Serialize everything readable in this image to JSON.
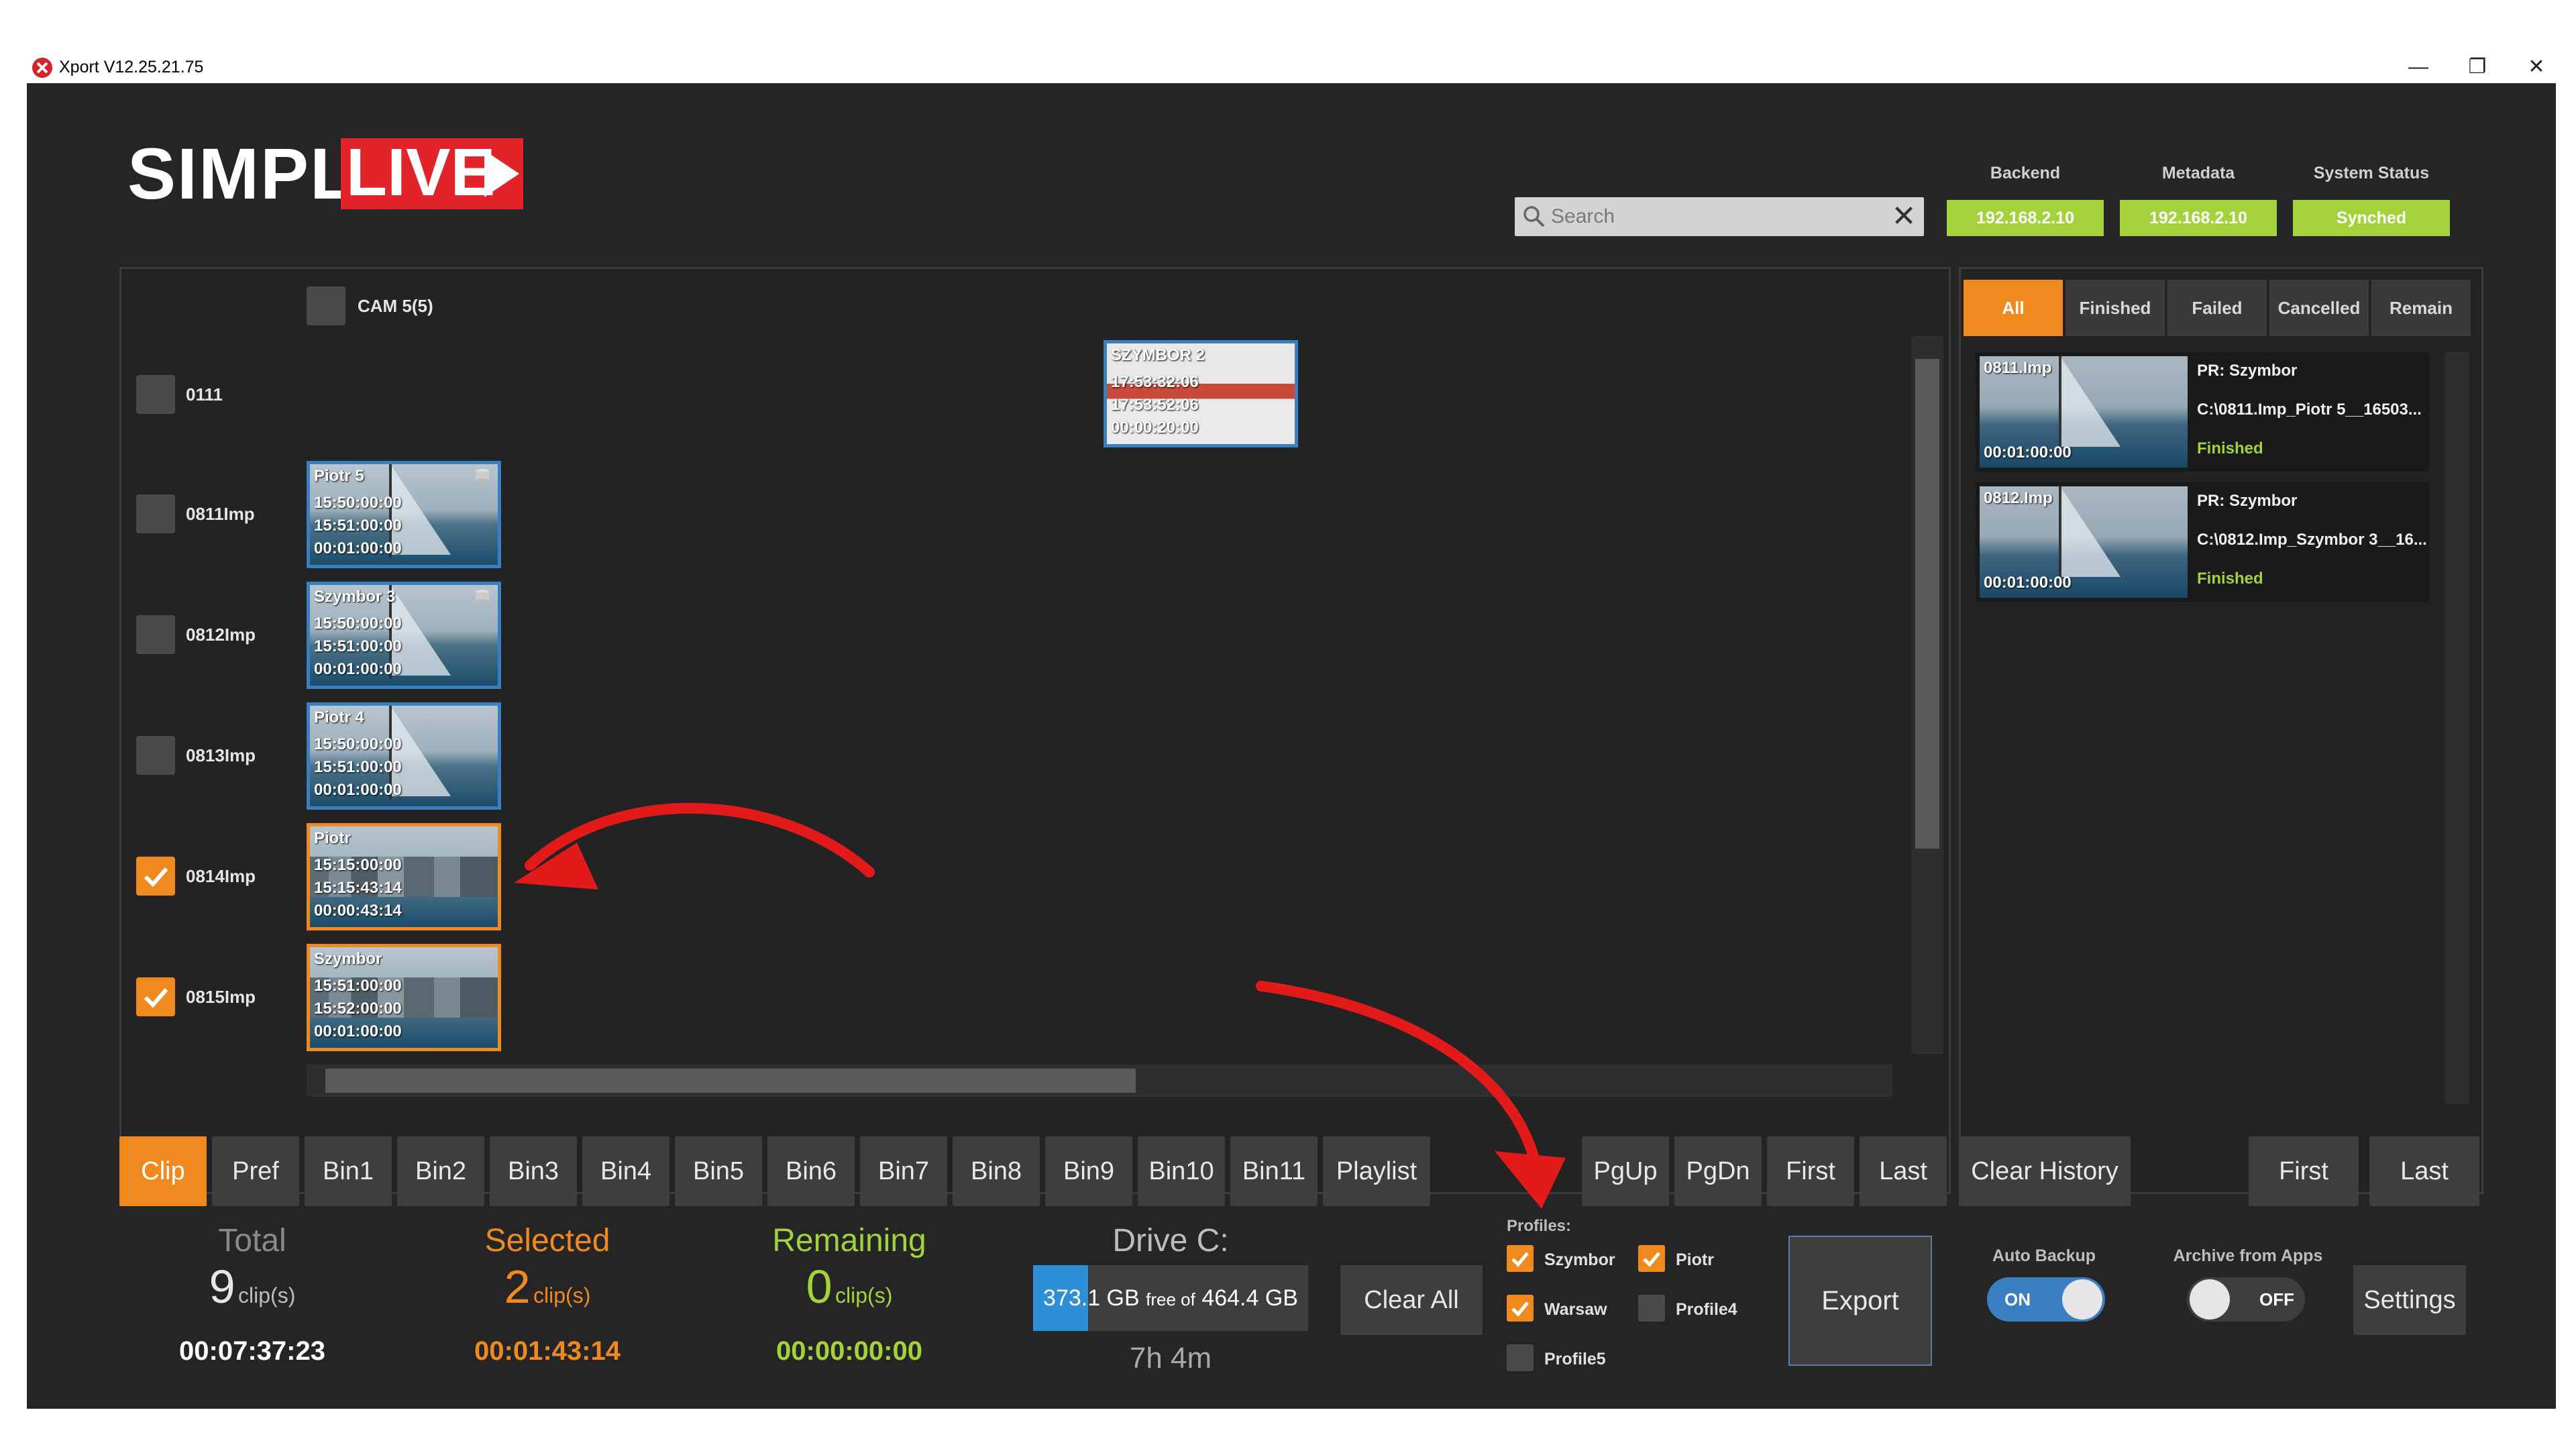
{
  "window": {
    "title": "Xport V12.25.21.75",
    "minimize": "—",
    "restore": "❐",
    "close": "✕"
  },
  "brand": {
    "simply": "SIMPLY",
    "live": "LIVE"
  },
  "search": {
    "placeholder": "Search",
    "clear": "✕"
  },
  "status": [
    {
      "label": "Backend",
      "value": "192.168.2.10"
    },
    {
      "label": "Metadata",
      "value": "192.168.2.10"
    },
    {
      "label": "System Status",
      "value": "Synched"
    }
  ],
  "clips": {
    "camera_label": "CAM 5(5)",
    "floating_clip": {
      "name": "SZYMBOR 2",
      "in": "17:53:32:06",
      "out": "17:53:52:06",
      "duration": "00:00:20:00"
    },
    "rows": [
      {
        "label": "0111",
        "checked": false
      },
      {
        "label": "0811Imp",
        "checked": false,
        "name": "Piotr 5",
        "in": "15:50:00:00",
        "out": "15:51:00:00",
        "duration": "00:01:00:00"
      },
      {
        "label": "0812Imp",
        "checked": false,
        "name": "Szymbor 3",
        "in": "15:50:00:00",
        "out": "15:51:00:00",
        "duration": "00:01:00:00"
      },
      {
        "label": "0813Imp",
        "checked": false,
        "name": "Piotr 4",
        "in": "15:50:00:00",
        "out": "15:51:00:00",
        "duration": "00:01:00:00"
      },
      {
        "label": "0814Imp",
        "checked": true,
        "name": "Piotr",
        "in": "15:15:00:00",
        "out": "15:15:43:14",
        "duration": "00:00:43:14"
      },
      {
        "label": "0815Imp",
        "checked": true,
        "name": "Szymbor",
        "in": "15:51:00:00",
        "out": "15:52:00:00",
        "duration": "00:01:00:00"
      }
    ]
  },
  "history": {
    "tabs": [
      "All",
      "Finished",
      "Failed",
      "Cancelled",
      "Remain"
    ],
    "active_tab": "All",
    "jobs": [
      {
        "clip": "0811.Imp",
        "duration": "00:01:00:00",
        "profile": "PR: Szymbor",
        "path": "C:\\0811.Imp_Piotr 5__16503...",
        "status": "Finished"
      },
      {
        "clip": "0812.Imp",
        "duration": "00:01:00:00",
        "profile": "PR: Szymbor",
        "path": "C:\\0812.Imp_Szymbor 3__16...",
        "status": "Finished"
      }
    ]
  },
  "bins": [
    "Clip",
    "Pref",
    "Bin1",
    "Bin2",
    "Bin3",
    "Bin4",
    "Bin5",
    "Bin6",
    "Bin7",
    "Bin8",
    "Bin9",
    "Bin10",
    "Bin11",
    "Playlist"
  ],
  "active_bin": "Clip",
  "paging": {
    "pgup": "PgUp",
    "pgdn": "PgDn",
    "first": "First",
    "last": "Last"
  },
  "history_controls": {
    "clear": "Clear History",
    "first": "First",
    "last": "Last"
  },
  "stats": {
    "total": {
      "label": "Total",
      "count": "9",
      "unit": "clip(s)",
      "time": "00:07:37:23"
    },
    "selected": {
      "label": "Selected",
      "count": "2",
      "unit": "clip(s)",
      "time": "00:01:43:14"
    },
    "remaining": {
      "label": "Remaining",
      "count": "0",
      "unit": "clip(s)",
      "time": "00:00:00:00"
    }
  },
  "drive": {
    "label": "Drive C:",
    "free": "373.1 GB",
    "free_of": "free of",
    "total": "464.4 GB",
    "used_fraction": 0.2,
    "time_left": "7h 4m"
  },
  "clear_all": "Clear All",
  "profiles": {
    "label": "Profiles:",
    "items": [
      {
        "name": "Szymbor",
        "checked": true
      },
      {
        "name": "Piotr",
        "checked": true
      },
      {
        "name": "Warsaw",
        "checked": true
      },
      {
        "name": "Profile4",
        "checked": false
      },
      {
        "name": "Profile5",
        "checked": false
      }
    ]
  },
  "export": "Export",
  "auto_backup": {
    "label": "Auto Backup",
    "state": "ON"
  },
  "archive": {
    "label": "Archive from Apps",
    "state": "OFF"
  },
  "settings": "Settings",
  "colors": {
    "accent": "#f08a1e",
    "status_ok": "#a3d23b",
    "selected_text": "#f08a1e",
    "remaining_text": "#a3d23b",
    "toggle_on": "#3a7fc1"
  }
}
